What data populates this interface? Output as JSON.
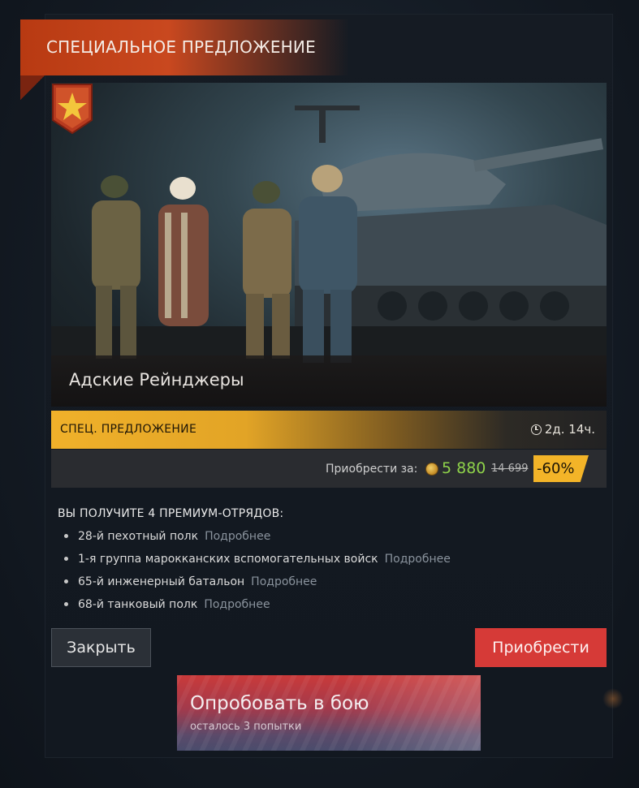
{
  "header": {
    "title": "СПЕЦИАЛЬНОЕ ПРЕДЛОЖЕНИЕ"
  },
  "hero": {
    "caption": "Адские Рейнджеры",
    "nation_icon": "usa-star-icon",
    "rank_icon": "rank-star-icon"
  },
  "offer": {
    "label": "СПЕЦ. ПРЕДЛОЖЕНИЕ",
    "timer": "2д. 14ч."
  },
  "price": {
    "label": "Приобрести за:",
    "currency_icon": "gold-coin-icon",
    "new_price": "5 880",
    "old_price": "14 699",
    "discount": "-60%"
  },
  "rewards": {
    "title": "ВЫ ПОЛУЧИТЕ 4 ПРЕМИУМ-ОТРЯДОВ:",
    "items": [
      {
        "name": "28-й пехотный полк",
        "more": "Подробнее"
      },
      {
        "name": "1-я группа марокканских вспомогательных войск",
        "more": "Подробнее"
      },
      {
        "name": "65-й инженерный батальон",
        "more": "Подробнее"
      },
      {
        "name": "68-й танковый полк",
        "more": "Подробнее"
      }
    ]
  },
  "buttons": {
    "close": "Закрыть",
    "buy": "Приобрести",
    "try_title": "Опробовать в бою",
    "try_sub": "осталось 3 попытки"
  },
  "colors": {
    "accent_red": "#d63a37",
    "offer_gold": "#f0b12a",
    "price_green": "#8fd34a"
  }
}
